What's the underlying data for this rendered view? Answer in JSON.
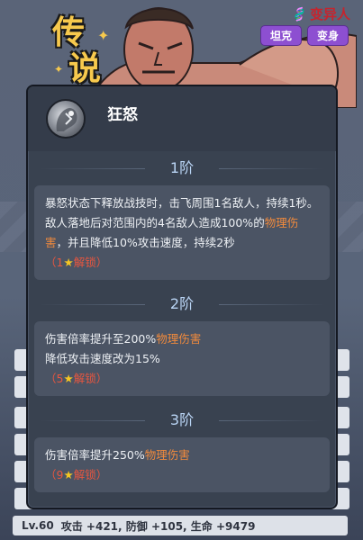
{
  "hero": {
    "rarity_title": [
      "传",
      "说"
    ],
    "role": "变异人",
    "tags": [
      "坦克",
      "变身"
    ]
  },
  "bottom_bar": {
    "level": "Lv.60",
    "stats": "攻击 +421, 防御 +105, 生命 +9479"
  },
  "skill": {
    "name": "狂怒",
    "icon": "rage-skill-icon",
    "tiers": [
      {
        "label": "1阶",
        "text_1": "暴怒状态下释放战技时，击飞周围1名敌人，持续1秒。敌人落地后对范围内的4名敌人造成100%的",
        "highlight": "物理伤害",
        "text_2": "，并且降低10%攻击速度，持续2秒",
        "unlock_open": "（",
        "unlock_num": "1",
        "unlock_label": "解锁",
        "unlock_close": "）"
      },
      {
        "label": "2阶",
        "line_1": "伤害倍率提升至200%",
        "highlight": "物理伤害",
        "line_2": "降低攻击速度改为15%",
        "unlock_open": "（",
        "unlock_num": "5",
        "unlock_label": "解锁",
        "unlock_close": "）"
      },
      {
        "label": "3阶",
        "line_1": "伤害倍率提升250%",
        "highlight": "物理伤害",
        "unlock_open": "（",
        "unlock_num": "9",
        "unlock_label": "解锁",
        "unlock_close": "）"
      }
    ]
  },
  "colors": {
    "highlight": "#f08a3d",
    "unlock": "#e8563f",
    "star": "#f5c623",
    "tag_bg": "#8d4fd1",
    "role": "#c6242d",
    "tier_label": "#b9d4f4"
  }
}
